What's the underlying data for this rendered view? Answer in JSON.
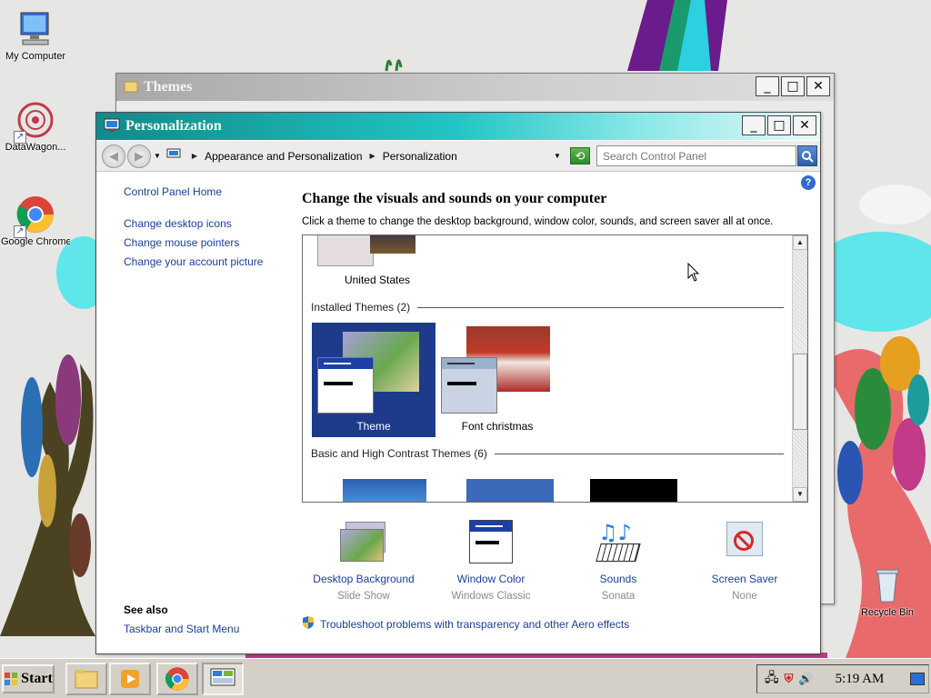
{
  "desktop": {
    "icons": [
      {
        "label": "My Computer"
      },
      {
        "label": "DataWagon..."
      },
      {
        "label": "Google Chrome"
      },
      {
        "label": "Recycle Bin"
      }
    ]
  },
  "themes_window": {
    "title": "Themes"
  },
  "window": {
    "title": "Personalization",
    "controls": {
      "minimize": "_",
      "maximize": "□",
      "close": "✕"
    }
  },
  "addressbar": {
    "crumbs": [
      "Appearance and Personalization",
      "Personalization"
    ],
    "search_placeholder": "Search Control Panel"
  },
  "leftnav": {
    "home": "Control Panel Home",
    "links": [
      "Change desktop icons",
      "Change mouse pointers",
      "Change your account picture"
    ],
    "see_also_header": "See also",
    "see_also_links": [
      "Taskbar and Start Menu"
    ]
  },
  "main": {
    "title": "Change the visuals and sounds on your computer",
    "subtitle": "Click a theme to change the desktop background, window color, sounds, and screen saver all at once.",
    "partial_theme": "United States",
    "installed_header": "Installed Themes (2)",
    "installed": [
      {
        "name": "Theme",
        "selected": true
      },
      {
        "name": "Font christmas",
        "selected": false
      }
    ],
    "basic_header": "Basic and High Contrast Themes (6)"
  },
  "settings": [
    {
      "label": "Desktop Background",
      "value": "Slide Show"
    },
    {
      "label": "Window Color",
      "value": "Windows Classic"
    },
    {
      "label": "Sounds",
      "value": "Sonata"
    },
    {
      "label": "Screen Saver",
      "value": "None"
    }
  ],
  "troubleshoot": "Troubleshoot problems with transparency and other Aero effects",
  "taskbar": {
    "start": "Start",
    "clock": "5:19 AM"
  },
  "colors": {
    "title_gradient": "#22c5c5",
    "link": "#1a3e9a",
    "selected_tile": "#1e3a8a"
  }
}
